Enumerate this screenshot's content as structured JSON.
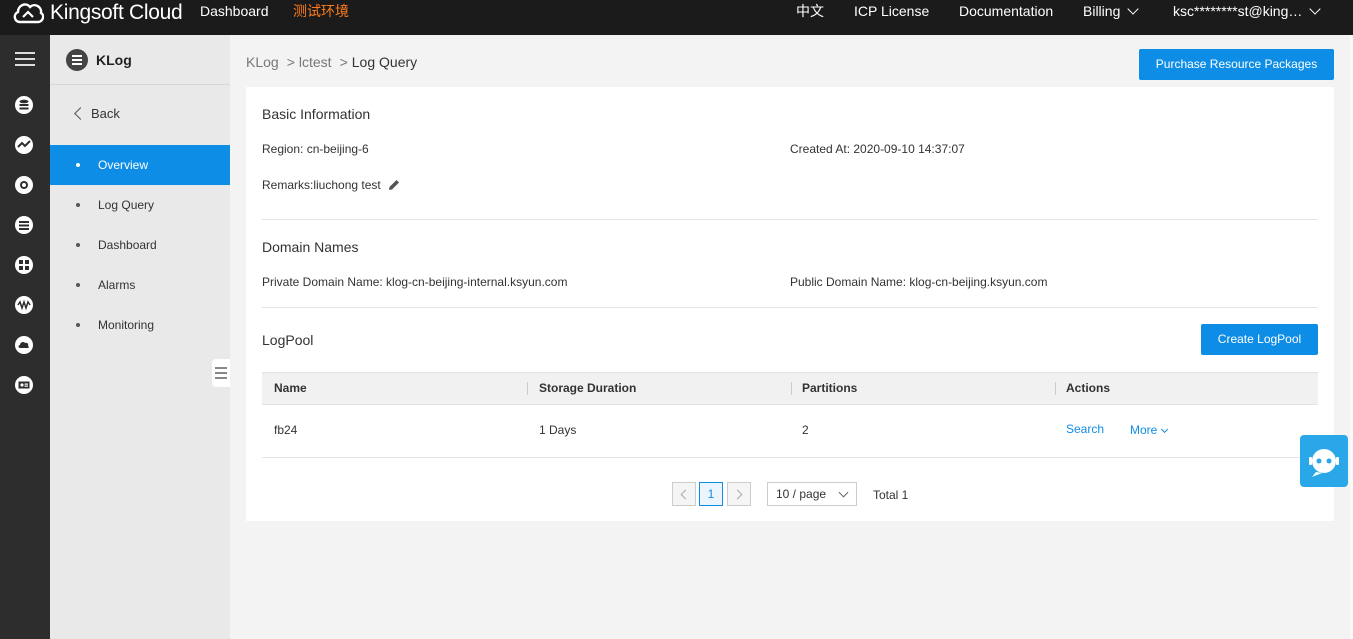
{
  "header": {
    "brand": "Kingsoft Cloud",
    "nav": {
      "dashboard": "Dashboard",
      "env": "测试环境",
      "lang": "中文",
      "icp": "ICP License",
      "docs": "Documentation",
      "billing": "Billing",
      "account": "ksc********st@king…"
    },
    "colors": {
      "bar": "#1b1b1b",
      "env": "#ff7b1a"
    }
  },
  "iconbar": {
    "icons": [
      "menu-icon",
      "database-icon",
      "chart-icon",
      "lifebuoy-icon",
      "storage-icon",
      "network-icon",
      "wave-icon",
      "cloud-upload-icon",
      "id-card-icon"
    ]
  },
  "sidebar": {
    "product": "KLog",
    "back": "Back",
    "items": [
      {
        "label": "Overview",
        "active": true
      },
      {
        "label": "Log Query",
        "active": false
      },
      {
        "label": "Dashboard",
        "active": false
      },
      {
        "label": "Alarms",
        "active": false
      },
      {
        "label": "Monitoring",
        "active": false
      }
    ],
    "active_color": "#0e8de6"
  },
  "breadcrumb": {
    "items": [
      "KLog",
      "lctest",
      "Log Query"
    ]
  },
  "purchase_button": "Purchase Resource Packages",
  "basic": {
    "title": "Basic Information",
    "region": "Region: cn-beijing-6",
    "created": "Created At: 2020-09-10 14:37:07",
    "remarks": "Remarks:liuchong test"
  },
  "domains": {
    "title": "Domain Names",
    "private": "Private Domain Name: klog-cn-beijing-internal.ksyun.com",
    "public": "Public Domain Name: klog-cn-beijing.ksyun.com"
  },
  "logpool": {
    "title": "LogPool",
    "create_button": "Create LogPool",
    "columns": [
      "Name",
      "Storage Duration",
      "Partitions",
      "Actions"
    ],
    "rows": [
      {
        "name": "fb24",
        "duration": "1 Days",
        "partitions": "2",
        "search": "Search",
        "more": "More"
      }
    ],
    "pagination": {
      "current": "1",
      "page_size": "10 / page",
      "total": "Total 1"
    }
  }
}
